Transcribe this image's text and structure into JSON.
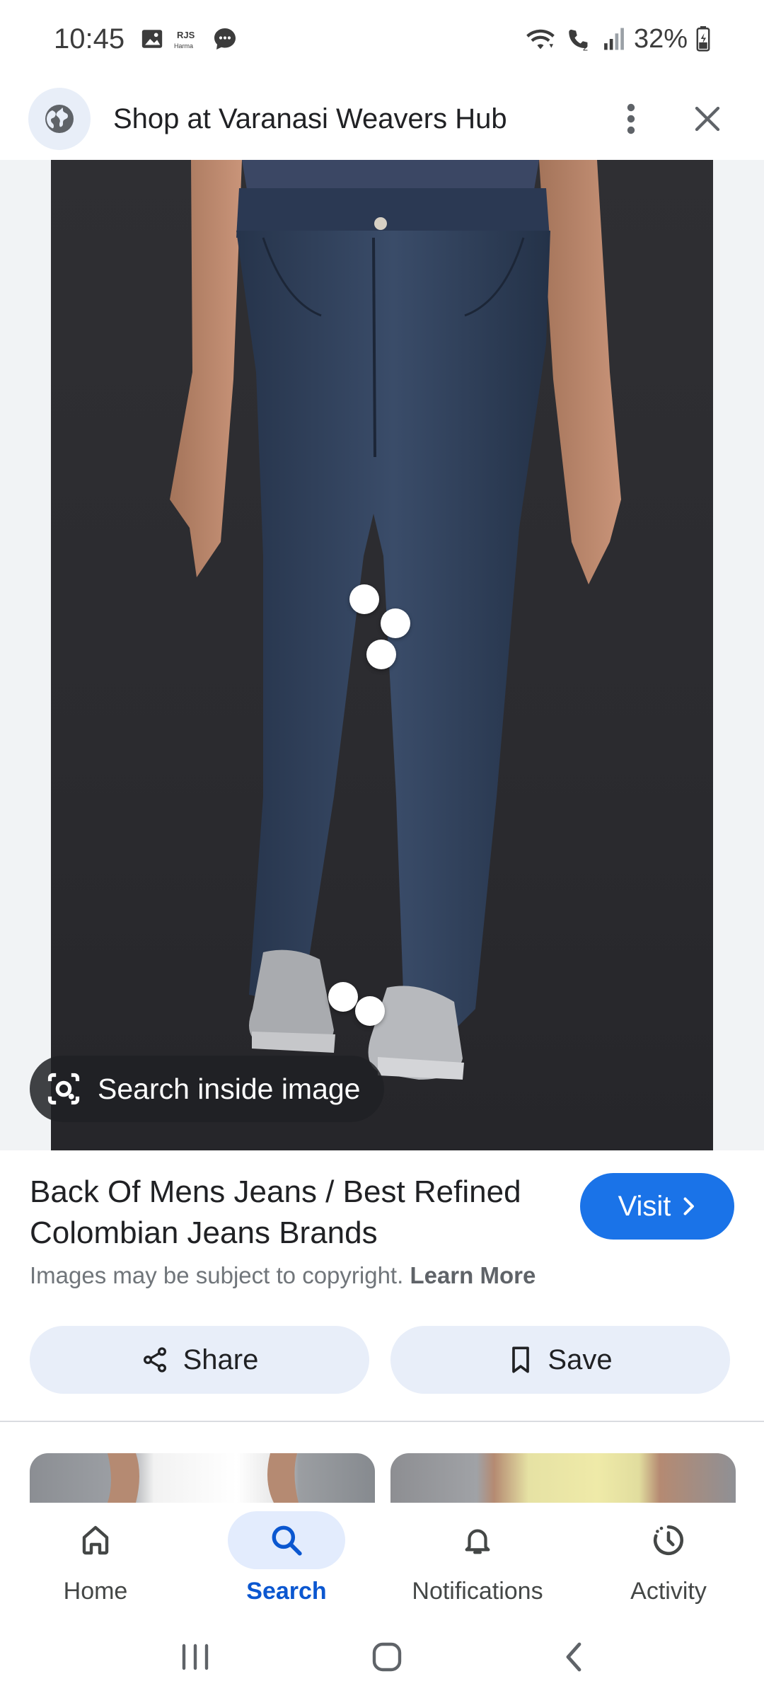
{
  "status_bar": {
    "time": "10:45",
    "battery": "32%",
    "icons": [
      "image-icon",
      "news-app-icon",
      "chat-icon",
      "wifi-icon",
      "wifi-call-icon",
      "signal-icon",
      "battery-icon"
    ]
  },
  "header": {
    "title": "Shop at Varanasi Weavers Hub",
    "icons": [
      "globe-icon",
      "more-vert-icon",
      "close-icon"
    ]
  },
  "image": {
    "lens_button_label": "Search inside image",
    "lens_icon": "lens-camera-icon"
  },
  "result": {
    "title": "Back Of Mens Jeans / Best Refined Colombian Jeans Brands",
    "visit_label": "Visit",
    "copyright_text": "Images may be subject to copyright.",
    "learn_more_label": "Learn More",
    "share_label": "Share",
    "save_label": "Save"
  },
  "bottom_nav": {
    "items": [
      {
        "label": "Home",
        "icon": "home-icon",
        "active": false
      },
      {
        "label": "Search",
        "icon": "search-icon",
        "active": true
      },
      {
        "label": "Notifications",
        "icon": "bell-icon",
        "active": false
      },
      {
        "label": "Activity",
        "icon": "activity-icon",
        "active": false
      }
    ]
  },
  "system_nav": [
    "recents-icon",
    "home-circle-icon",
    "back-icon"
  ],
  "colors": {
    "accent": "#1a73e8",
    "active_nav": "#0b57d0",
    "chip_bg": "#e8eef9",
    "photo_bg": "#2e2e32",
    "denim": "#2f3f58"
  }
}
